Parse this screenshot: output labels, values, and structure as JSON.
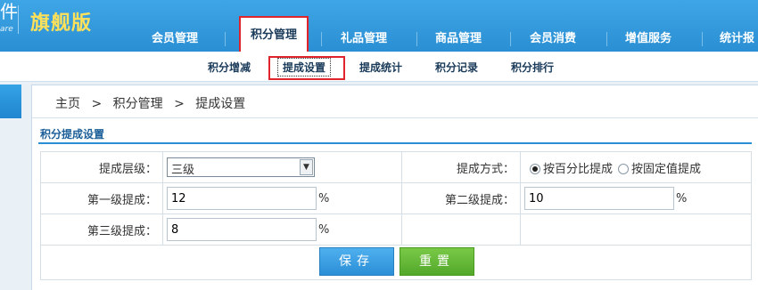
{
  "header": {
    "logo_partial": "件",
    "logo_sub": "are",
    "edition": "旗舰版",
    "nav": [
      {
        "label": "会员管理"
      },
      {
        "label": "积分管理"
      },
      {
        "label": "礼品管理"
      },
      {
        "label": "商品管理"
      },
      {
        "label": "会员消费"
      },
      {
        "label": "增值服务"
      },
      {
        "label": "统计报"
      }
    ]
  },
  "subnav": [
    {
      "label": "积分增减"
    },
    {
      "label": "提成设置"
    },
    {
      "label": "提成统计"
    },
    {
      "label": "积分记录"
    },
    {
      "label": "积分排行"
    }
  ],
  "breadcrumb": [
    "主页",
    ">",
    "积分管理",
    ">",
    "提成设置"
  ],
  "section_title": "积分提成设置",
  "form": {
    "level_label": "提成层级：",
    "level_value": "三级",
    "mode_label": "提成方式：",
    "mode_percent": "按百分比提成",
    "mode_fixed": "按固定值提成",
    "first_label": "第一级提成：",
    "first_value": "12",
    "second_label": "第二级提成：",
    "second_value": "10",
    "third_label": "第三级提成：",
    "third_value": "8",
    "unit": "%"
  },
  "buttons": {
    "save": "保存",
    "reset": "重置"
  },
  "colors": {
    "brand": "#2a8fd3",
    "edition": "#ffe15a",
    "highlight": "#e0242b",
    "save": "#2b8fd7",
    "reset": "#53a82a"
  }
}
